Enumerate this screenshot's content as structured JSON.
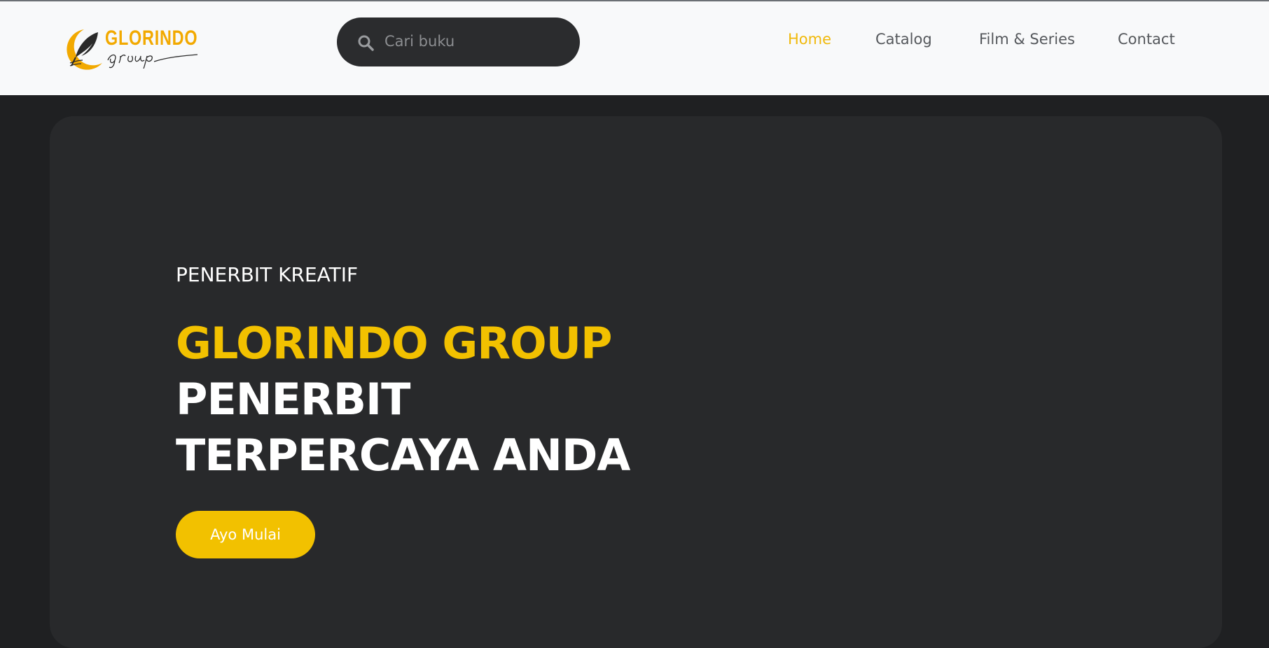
{
  "header": {
    "logo": {
      "brand_text": "GLORINDO",
      "script_text": "group",
      "accent_color": "#f2a900"
    },
    "search": {
      "placeholder": "Cari buku",
      "value": "",
      "icon": "search-icon"
    },
    "nav": {
      "items": [
        {
          "label": "Home",
          "active": true
        },
        {
          "label": "Catalog",
          "active": false
        },
        {
          "label": "Film & Series",
          "active": false
        },
        {
          "label": "Contact",
          "active": false
        }
      ]
    }
  },
  "hero": {
    "kicker": "PENERBIT KREATIF",
    "title_line1": "GLORINDO GROUP",
    "title_line2": "PENERBIT",
    "title_line3": "TERPERCAYA ANDA",
    "cta_label": "Ayo Mulai"
  },
  "colors": {
    "accent": "#f2c100",
    "nav_active": "#f0b90b",
    "header_bg": "#f8f9fa",
    "page_bg": "#1f2022",
    "hero_card_bg": "#28292b",
    "search_bg": "#2b2c2e"
  }
}
